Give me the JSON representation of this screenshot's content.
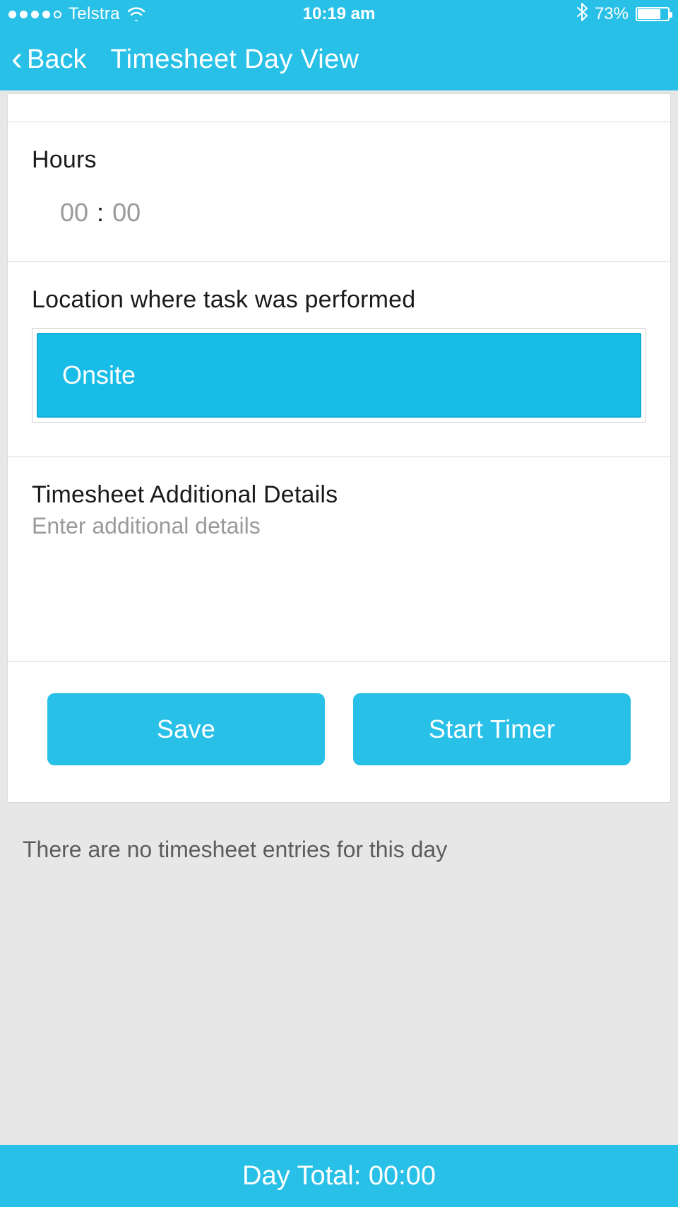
{
  "status_bar": {
    "carrier": "Telstra",
    "time": "10:19 am",
    "battery_pct": "73%",
    "signal_filled": 4,
    "signal_total": 5
  },
  "nav": {
    "back_label": "Back",
    "title": "Timesheet Day View"
  },
  "form": {
    "hours": {
      "label": "Hours",
      "hh": "00",
      "mm": "00"
    },
    "location": {
      "label": "Location where task was performed",
      "selected": "Onsite"
    },
    "details": {
      "label": "Timesheet Additional Details",
      "placeholder": "Enter additional details",
      "value": ""
    },
    "actions": {
      "save": "Save",
      "start_timer": "Start Timer"
    }
  },
  "list": {
    "empty_message": "There are no timesheet entries for this day"
  },
  "footer": {
    "total_label": "Day Total:",
    "total_value": "00:00"
  }
}
